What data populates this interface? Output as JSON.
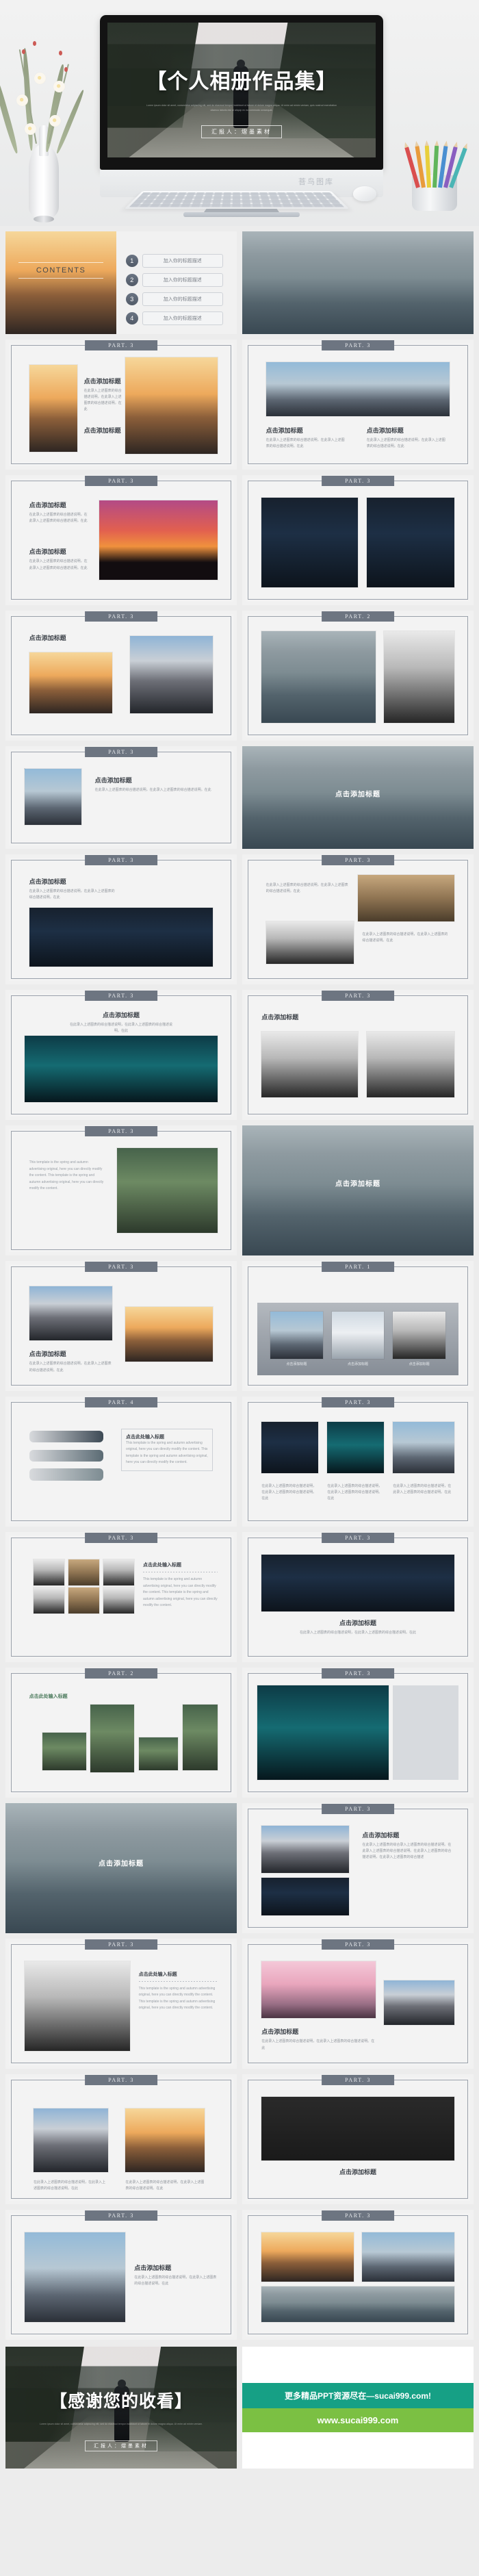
{
  "hero": {
    "slide_title": "【个人相册作品集】",
    "slide_sub": "Lorem ipsum dolor sit amet, consectetur adipiscing elit, sed do eiusmod tempor incididunt ut labore et dolore magna aliqua. Ut enim ad minim veniam, quis nostrud exercitation ullamco laboris nisi ut aliquip ex ea commodo consequat.",
    "presenter": "汇报人：熠墨素材",
    "monitor_brand": "菩鸟图库"
  },
  "labels": {
    "contents_heading": "CONTENTS",
    "part1": "PART. 1",
    "part2": "PART. 2",
    "part3": "PART. 3",
    "part4": "PART. 4",
    "click_add_title": "点击添加标题",
    "click_input_title": "点击此处输入标题",
    "body_cn_short": "在此录入上述图表的综合描述说明，在此录入上述图表的综合描述说明。在此",
    "body_cn_long": "在此录入上述图表的综合录入上述图表的综合描述说明。在此录入上述图表的综合描述说明。在此录入上述图表的综合描述说明，在此录入上述图表的综合描述",
    "body_en": "This template is the spring and autumn advertising original, here you can directly modify the content. This template is the spring and autumn advertising original, here you can directly modify the content."
  },
  "contents": {
    "heading": "CONTENTS",
    "items": [
      {
        "num": "1",
        "label": "加入你的标题描述"
      },
      {
        "num": "2",
        "label": "加入你的标题描述"
      },
      {
        "num": "3",
        "label": "加入你的标题描述"
      },
      {
        "num": "4",
        "label": "加入你的标题描述"
      }
    ]
  },
  "footer": {
    "thanks_title": "【感谢您的收看】",
    "thanks_sub": "Lorem ipsum dolor sit amet, consectetur adipiscing elit, sed do eiusmod tempor incididunt ut labore et dolore magna aliqua. Ut enim ad minim veniam.",
    "thanks_presenter": "汇报人：熠墨素材",
    "promo_line1": "更多精品PPT资源尽在—sucai999.com!",
    "promo_line2": "www.sucai999.com"
  },
  "colors": {
    "page_bg": "#ececec",
    "slide_bg": "#f3f3f3",
    "part_tag_bg": "#6d7581",
    "accent_teal": "#16a085",
    "accent_green": "#7bc043",
    "title_text": "#3e434a",
    "body_text": "#8f949b"
  }
}
